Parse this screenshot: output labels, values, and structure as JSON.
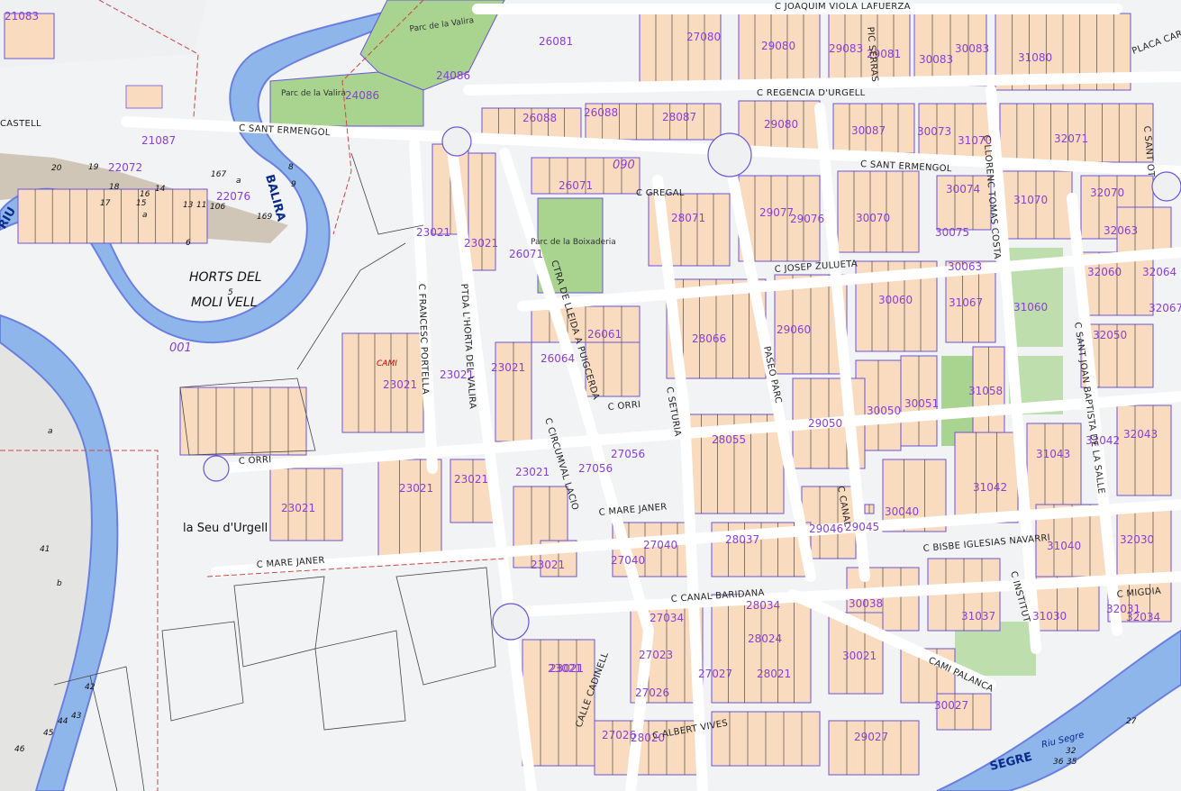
{
  "map": {
    "colors": {
      "background": "#f2f3f5",
      "building": "#f9dcc0",
      "block_outline": "#6b55d9",
      "road": "#ffffff",
      "park": "#a9d48f",
      "river": "#8fb6ea",
      "river_edge": "#6a7fe0",
      "label": "#8a3fd6",
      "boundary": "#d04545"
    },
    "place_name": "la Seu d'Urgell",
    "area_name": [
      "HORTS DEL",
      "MOLI VELL"
    ],
    "area_sub": "5",
    "rivers": {
      "balira": "BALIRA",
      "riu": "RIU",
      "segre": "SEGRE",
      "segre_small": "Riu Segre"
    },
    "sectors": {
      "s001": "001",
      "s090": "090"
    },
    "parks": {
      "valira1": "Parc de la Valira",
      "valira2": "Parc de la Valira",
      "boixaderia": "Parc de la Boixaderia"
    },
    "streets": {
      "joaquim": "C JOAQUIM VIOLA LAFUERZA",
      "regencia": "C REGENCIA D'URGELL",
      "sant_ermengol_w": "C SANT ERMENGOL",
      "sant_ermengol_e": "C SANT ERMENGOL",
      "gregal": "C GREGAL",
      "zulueta": "C JOSEP ZULUETA",
      "orri_w": "C ORRI",
      "orri_e": "C ORRI",
      "mare_janer_w": "C MARE JANER",
      "mare_janer_e": "C MARE JANER",
      "canal_baridana": "C CANAL BARIDANA",
      "bisbe": "C BISBE IGLESIAS NAVARRI",
      "cami_palanca": "CAMI PALANCA",
      "albert_vives": "C ALBERT VIVES",
      "calle_cadinell": "CALLE CADINELL",
      "francesc": "C FRANCESC PORTELLA",
      "horta": "PTDA L'HORTA DEL VALIRA",
      "lisboa": "CTRA DE LLEIDA A PUIGCERDA",
      "circumval": "C CIRCUMVAL LACIO",
      "seturia": "C SETURIA",
      "paseo": "PASEO PARC",
      "llorenc": "C LLORENC TOMAS COSTA",
      "sant_joan": "C SANT JOAN BAPTISTA DE LA SALLE",
      "canal": "C CANAL",
      "sant_ot": "C SANT OT",
      "placa": "PLACA CARM",
      "migdia": "C MIGDIA",
      "institut": "C INSTITUT",
      "pic_serrats": "PIC SERRAS",
      "cami": "CAMI",
      "castell": "CASTELL"
    },
    "parcels": [
      "21083",
      "26081",
      "27080",
      "29080",
      "29083",
      "29081",
      "30083",
      "30083",
      "31080",
      "24086",
      "24086",
      "26088",
      "26088",
      "28087",
      "29080",
      "30087",
      "30073",
      "31070",
      "32071",
      "21087",
      "22072",
      "22076",
      "26071",
      "28071",
      "29077",
      "29076",
      "30070",
      "30074",
      "31070",
      "32070",
      "23021",
      "23021",
      "26071",
      "30075",
      "32063",
      "30063",
      "32060",
      "32064",
      "31067",
      "31060",
      "30060",
      "29060",
      "28066",
      "26061",
      "26064",
      "32050",
      "32067",
      "23021",
      "23021",
      "23021",
      "30051",
      "31058",
      "30050",
      "29050",
      "28055",
      "27056",
      "27056",
      "23021",
      "23021",
      "23021",
      "23021",
      "31043",
      "32042",
      "32043",
      "31042",
      "30040",
      "23021",
      "29046",
      "29045",
      "27040",
      "27040",
      "28037",
      "31040",
      "32030",
      "23021",
      "30038",
      "31037",
      "31030",
      "32031",
      "32034",
      "28034",
      "27034",
      "23021",
      "27023",
      "28024",
      "28021",
      "27027",
      "30021",
      "27026",
      "28020",
      "30027",
      "29027",
      "27026"
    ],
    "plot_numbers": [
      "20",
      "19",
      "18",
      "17",
      "16",
      "15",
      "14",
      "13",
      "11",
      "a",
      "a",
      "6",
      "41",
      "42",
      "43",
      "44",
      "45",
      "46",
      "b",
      "a",
      "8",
      "9",
      "106",
      "167",
      "169",
      "32",
      "27",
      "36",
      "35"
    ]
  }
}
